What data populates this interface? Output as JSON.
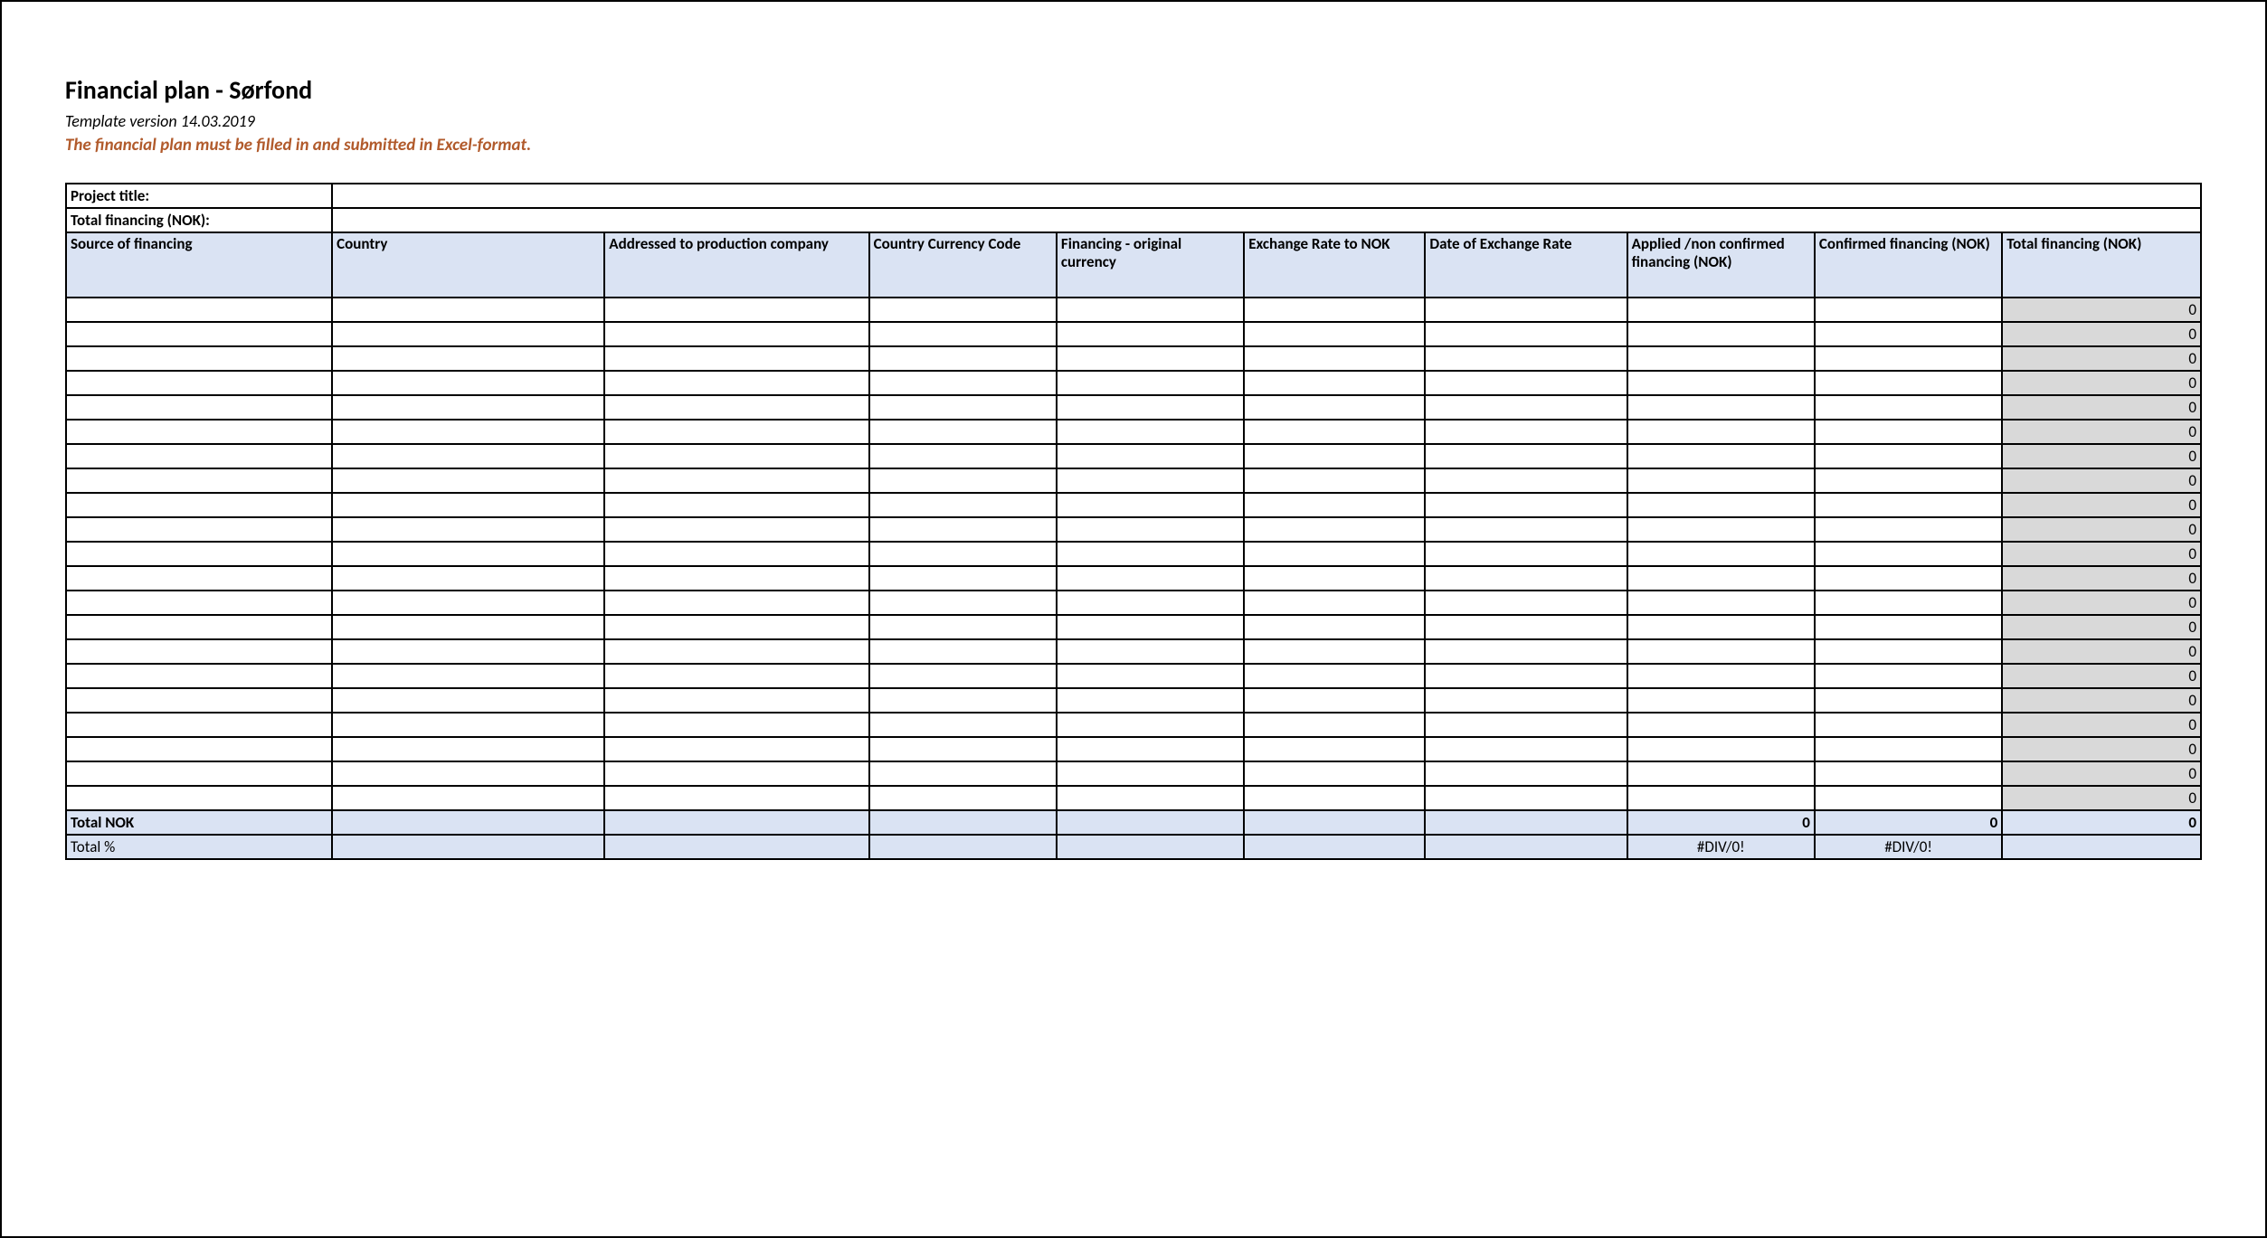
{
  "header": {
    "title": "Financial plan - Sørfond",
    "template_version": "Template version 14.03.2019",
    "warning": "The financial plan must be filled in and submitted in Excel-format."
  },
  "meta": {
    "project_title_label": "Project title:",
    "total_financing_label": "Total financing (NOK):",
    "project_title_value": "",
    "total_financing_value": ""
  },
  "columns": [
    "Source of financing",
    "Country",
    "Addressed to production company",
    "Country Currency Code",
    "Financing - original currency",
    "Exchange Rate to NOK",
    "Date of Exchange Rate",
    "Applied /non confirmed financing (NOK)",
    "Confirmed financing (NOK)",
    "Total financing (NOK)"
  ],
  "rows": [
    {
      "total": "0"
    },
    {
      "total": "0"
    },
    {
      "total": "0"
    },
    {
      "total": "0"
    },
    {
      "total": "0"
    },
    {
      "total": "0"
    },
    {
      "total": "0"
    },
    {
      "total": "0"
    },
    {
      "total": "0"
    },
    {
      "total": "0"
    },
    {
      "total": "0"
    },
    {
      "total": "0"
    },
    {
      "total": "0"
    },
    {
      "total": "0"
    },
    {
      "total": "0"
    },
    {
      "total": "0"
    },
    {
      "total": "0"
    },
    {
      "total": "0"
    },
    {
      "total": "0"
    },
    {
      "total": "0"
    },
    {
      "total": "0"
    }
  ],
  "totals": {
    "total_nok_label": "Total NOK",
    "applied_total": "0",
    "confirmed_total": "0",
    "grand_total": "0",
    "total_pct_label": "Total %",
    "applied_pct": "#DIV/0!",
    "confirmed_pct": "#DIV/0!"
  }
}
